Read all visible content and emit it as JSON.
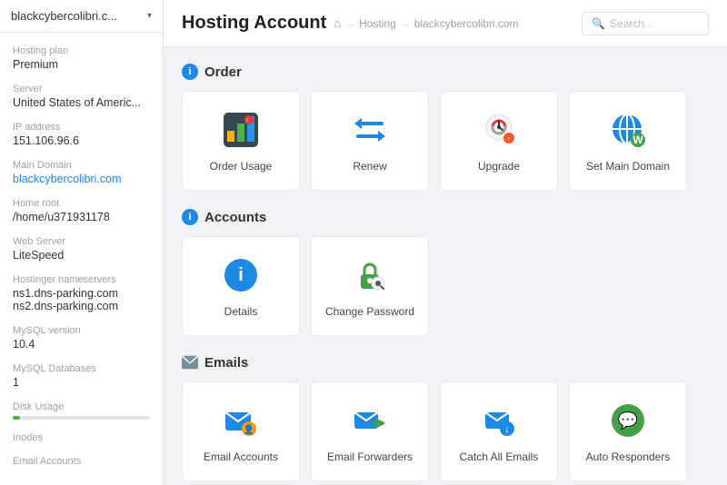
{
  "sidebar": {
    "account_name": "blackcybercolibri.c...",
    "fields": [
      {
        "label": "Hosting plan",
        "value": "Premium",
        "type": "text"
      },
      {
        "label": "Server",
        "value": "United States of Americ...",
        "type": "text"
      },
      {
        "label": "IP address",
        "value": "151.106.96.6",
        "type": "text"
      },
      {
        "label": "Main Domain",
        "value": "blackcybercolibri.com",
        "type": "link"
      },
      {
        "label": "Home root",
        "value": "/home/u371931178",
        "type": "text"
      },
      {
        "label": "Web Server",
        "value": "LiteSpeed",
        "type": "text"
      },
      {
        "label": "Hostinger nameservers",
        "value": "ns1.dns-parking.com\nns2.dns-parking.com",
        "type": "text"
      },
      {
        "label": "MySQL version",
        "value": "10.4",
        "type": "text"
      },
      {
        "label": "MySQL Databases",
        "value": "1",
        "type": "text"
      },
      {
        "label": "Disk Usage",
        "value": "",
        "type": "bar"
      },
      {
        "label": "Inodes",
        "value": "",
        "type": "text"
      },
      {
        "label": "Email Accounts",
        "value": "",
        "type": "text"
      }
    ]
  },
  "topbar": {
    "title": "Hosting Account",
    "breadcrumb_home": "🏠",
    "breadcrumb_sep1": "→",
    "breadcrumb_item1": "Hosting",
    "breadcrumb_sep2": "→",
    "breadcrumb_item2": "blackcybercolibri.com",
    "search_placeholder": "Search..."
  },
  "sections": [
    {
      "id": "order",
      "title": "Order",
      "icon_type": "info",
      "cards": [
        {
          "label": "Order Usage",
          "icon": "order-usage"
        },
        {
          "label": "Renew",
          "icon": "renew"
        },
        {
          "label": "Upgrade",
          "icon": "upgrade"
        },
        {
          "label": "Set Main Domain",
          "icon": "set-main-domain"
        }
      ]
    },
    {
      "id": "accounts",
      "title": "Accounts",
      "icon_type": "info",
      "cards": [
        {
          "label": "Details",
          "icon": "details"
        },
        {
          "label": "Change Password",
          "icon": "change-password"
        }
      ]
    },
    {
      "id": "emails",
      "title": "Emails",
      "icon_type": "email",
      "cards": [
        {
          "label": "Email Accounts",
          "icon": "email-accounts"
        },
        {
          "label": "Email Forwarders",
          "icon": "email-forwarders"
        },
        {
          "label": "Catch All Emails",
          "icon": "catch-all-emails"
        },
        {
          "label": "Auto Responders",
          "icon": "auto-responders"
        }
      ]
    }
  ]
}
